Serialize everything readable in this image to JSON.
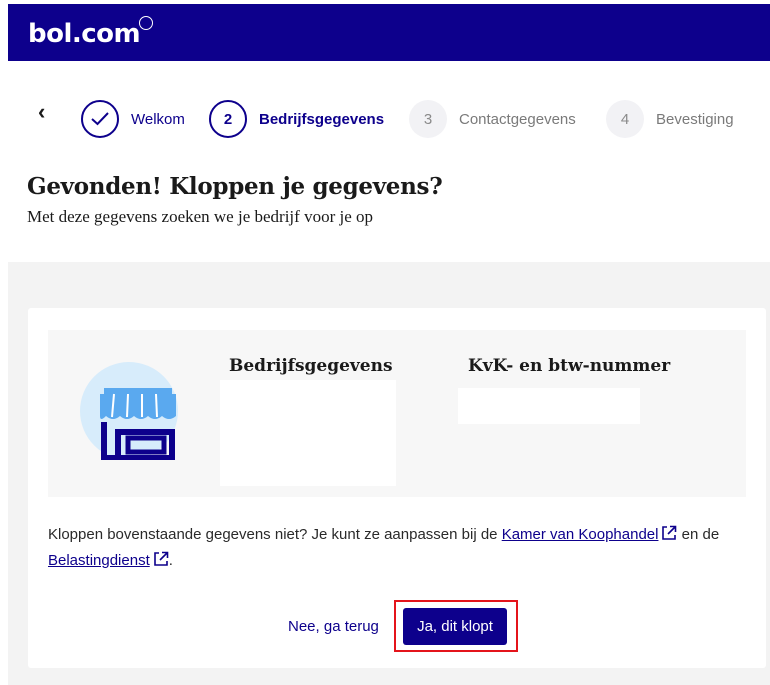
{
  "header": {
    "logo": "bol.com"
  },
  "stepper": {
    "back_label": "‹",
    "steps": [
      {
        "number": "✓",
        "label": "Welkom",
        "state": "done"
      },
      {
        "number": "2",
        "label": "Bedrijfsgegevens",
        "state": "active"
      },
      {
        "number": "3",
        "label": "Contactgegevens",
        "state": "todo"
      },
      {
        "number": "4",
        "label": "Bevestiging",
        "state": "todo"
      }
    ]
  },
  "main": {
    "title": "Gevonden! Kloppen je gegevens?",
    "subtitle": "Met deze gegevens zoeken we je bedrijf voor je op"
  },
  "card": {
    "col1_heading": "Bedrijfsgegevens",
    "col2_heading": "KvK- en btw-nummer",
    "note_part1": "Kloppen bovenstaande gegevens niet? Je kunt ze aanpassen bij de ",
    "link_kvk": "Kamer van Koophandel",
    "note_part2": " en de ",
    "link_belasting": "Belastingdienst",
    "note_part3": ".",
    "btn_back": "Nee, ga terug",
    "btn_confirm": "Ja, dit klopt"
  },
  "colors": {
    "brand": "#0d008c",
    "highlight": "#e4141b",
    "shop_blue": "#5aa9ef"
  }
}
